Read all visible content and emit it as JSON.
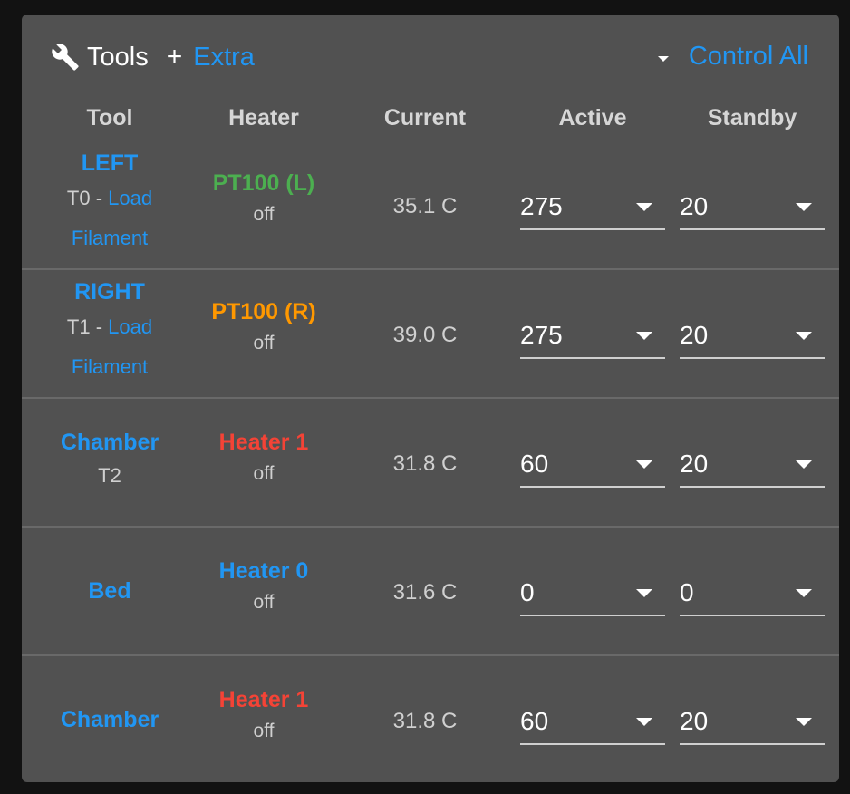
{
  "header": {
    "title": "Tools",
    "title_icon": "wrench-icon",
    "plus": "+",
    "extra_label": "Extra",
    "control_all_label": "Control All"
  },
  "columns": [
    "Tool",
    "Heater",
    "Current",
    "Active",
    "Standby"
  ],
  "colors": {
    "accent": "#2196f3",
    "heater_green": "#4caf50",
    "heater_orange": "#ff9800",
    "heater_red": "#f44336",
    "heater_blue": "#2196f3",
    "panel_bg": "#515151",
    "page_bg": "#121212"
  },
  "rows": [
    {
      "tool": "LEFT",
      "tool_number": "T0",
      "separator": " - ",
      "link_line1": "Load",
      "link_line2": "Filament",
      "heater": "PT100 (L)",
      "heater_color": "#4caf50",
      "state": "off",
      "current": "35.1 C",
      "active": "275",
      "standby": "20"
    },
    {
      "tool": "RIGHT",
      "tool_number": "T1",
      "separator": " - ",
      "link_line1": "Load",
      "link_line2": "Filament",
      "heater": "PT100 (R)",
      "heater_color": "#ff9800",
      "state": "off",
      "current": "39.0 C",
      "active": "275",
      "standby": "20"
    },
    {
      "tool": "Chamber",
      "tool_number": "T2",
      "heater": "Heater 1",
      "heater_color": "#f44336",
      "state": "off",
      "current": "31.8 C",
      "active": "60",
      "standby": "20"
    },
    {
      "tool": "Bed",
      "heater": "Heater 0",
      "heater_color": "#2196f3",
      "state": "off",
      "current": "31.6 C",
      "active": "0",
      "standby": "0"
    },
    {
      "tool": "Chamber",
      "heater": "Heater 1",
      "heater_color": "#f44336",
      "state": "off",
      "current": "31.8 C",
      "active": "60",
      "standby": "20"
    }
  ]
}
